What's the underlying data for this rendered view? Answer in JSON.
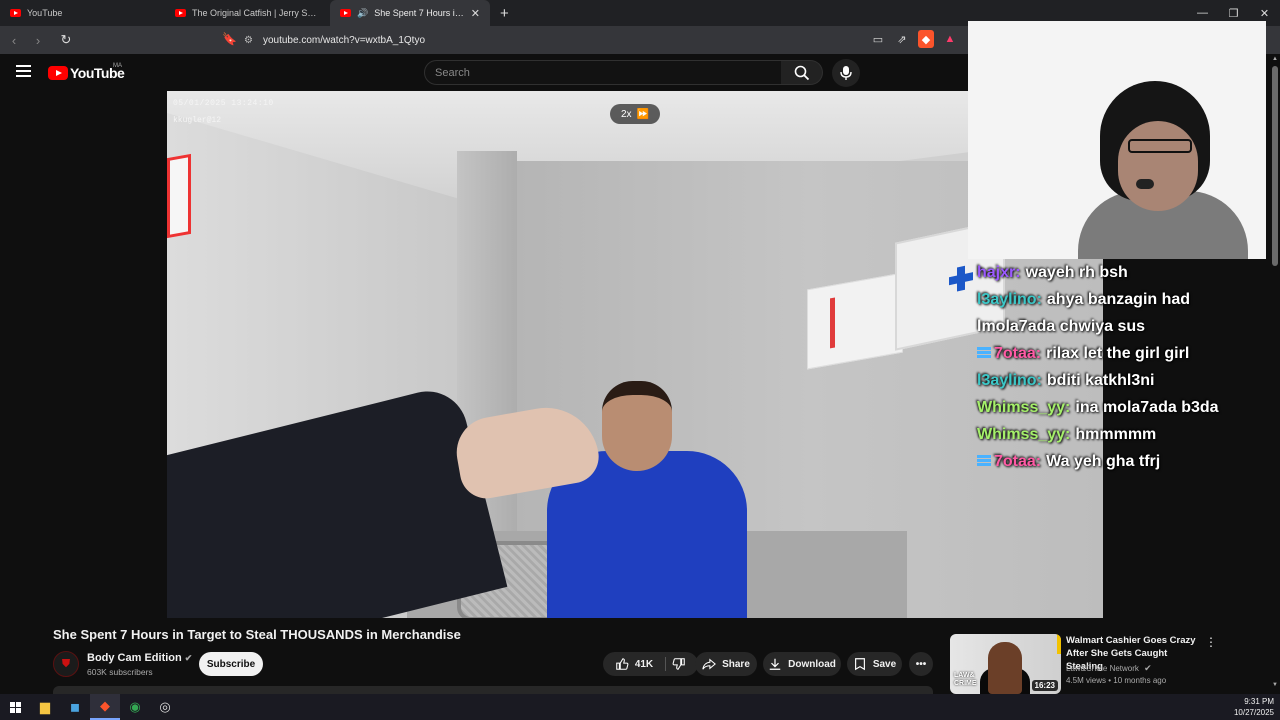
{
  "browser": {
    "tabs": [
      {
        "label": "YouTube",
        "active": false
      },
      {
        "label": "The Original Catfish | Jerry Springer",
        "active": false
      },
      {
        "label": "She Spent 7 Hours in Target to Steal THOUSANDS in Merchandise",
        "active": true
      }
    ],
    "url": "youtube.com/watch?v=wxtbA_1Qtyo"
  },
  "youtube": {
    "logo_text": "YouTube",
    "country_code": "MA",
    "search_placeholder": "Search"
  },
  "player": {
    "timestamp_line1": "05/01/2025 13:24:10",
    "timestamp_line2": "kkugler@12",
    "speed_label": "2x"
  },
  "chat": [
    {
      "user": "hajxr:",
      "message": "wayeh rh bsh",
      "color": "#9b59ff",
      "badge": false
    },
    {
      "user": "l3aylino:",
      "message": "ahya banzagin had",
      "color": "#3cc8c8",
      "badge": false
    },
    {
      "user": "",
      "message": "lmola7ada chwiya sus",
      "color": "#ffffff",
      "badge": false
    },
    {
      "user": "7otaa:",
      "message": "rilax let the girl girl",
      "color": "#ff5aa5",
      "badge": true
    },
    {
      "user": "l3aylino:",
      "message": "bditi katkhl3ni",
      "color": "#3cc8c8",
      "badge": false
    },
    {
      "user": "Whimss_yy:",
      "message": "ina mola7ada b3da",
      "color": "#a5f06a",
      "badge": false
    },
    {
      "user": "Whimss_yy:",
      "message": "hmmmmm",
      "color": "#a5f06a",
      "badge": false
    },
    {
      "user": "7otaa:",
      "message": "Wa yeh gha tfrj",
      "color": "#ff5aa5",
      "badge": true
    }
  ],
  "video": {
    "title": "She Spent 7 Hours in Target to Steal THOUSANDS in Merchandise",
    "channel": "Body Cam Edition",
    "subscribers": "603K subscribers",
    "subscribe_label": "Subscribe",
    "likes": "41K",
    "share_label": "Share",
    "download_label": "Download",
    "save_label": "Save"
  },
  "recommendation": {
    "title": "Walmart Cashier Goes Crazy After She Gets Caught Stealing",
    "channel": "Law&Crime Network",
    "meta": "4.5M views • 10 months ago",
    "duration": "16:23",
    "thumb_brand_line1": "LAW&",
    "thumb_brand_line2": "CRIME"
  },
  "taskbar": {
    "time": "9:31 PM",
    "date": "10/27/2025"
  },
  "colors": {
    "youtube_red": "#ff0000",
    "background": "#0f0f0f",
    "shirt_blue": "#1f3fbf"
  }
}
